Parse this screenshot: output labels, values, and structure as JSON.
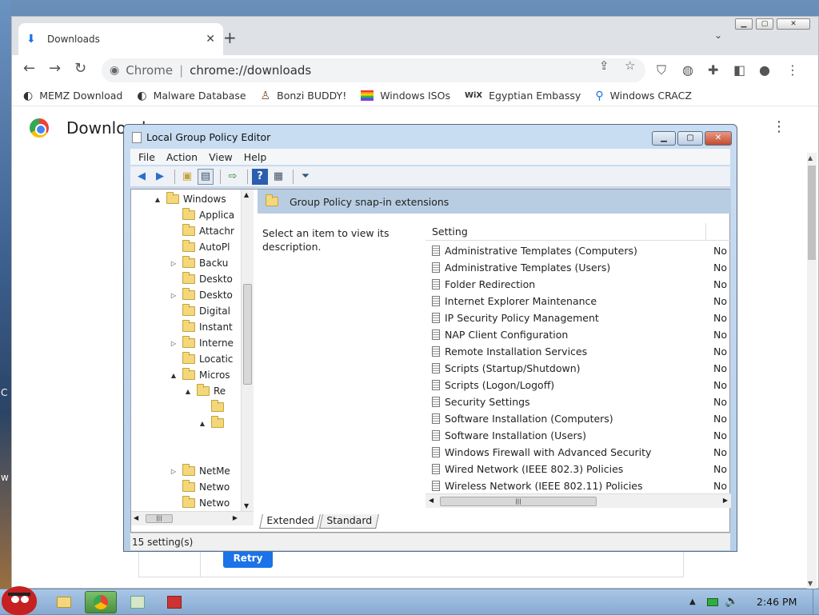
{
  "desktop": {
    "fragment_1": "C",
    "fragment_2": "w"
  },
  "chrome": {
    "tab_title": "Downloads",
    "omnibox_site": "Chrome",
    "omnibox_url": "chrome://downloads",
    "page_title": "Downloads",
    "retry_label": "Retry",
    "bookmarks": [
      {
        "label": "MEMZ Download",
        "icon": "globe-icon"
      },
      {
        "label": "Malware Database",
        "icon": "globe-icon"
      },
      {
        "label": "Bonzi BUDDY!",
        "icon": "bonzi-icon"
      },
      {
        "label": "Windows ISOs",
        "icon": "windows-flag-icon"
      },
      {
        "label": "Egyptian Embassy",
        "icon": "wix-icon"
      },
      {
        "label": "Windows CRACZ",
        "icon": "search-icon"
      }
    ]
  },
  "gpedit": {
    "title": "Local Group Policy Editor",
    "menu": [
      "File",
      "Action",
      "View",
      "Help"
    ],
    "tree": [
      {
        "label": "Windows",
        "expander": "▲",
        "indent": 0
      },
      {
        "label": "Applica",
        "expander": "",
        "indent": 1
      },
      {
        "label": "Attachr",
        "expander": "",
        "indent": 1
      },
      {
        "label": "AutoPl",
        "expander": "",
        "indent": 1
      },
      {
        "label": "Backu",
        "expander": "▷",
        "indent": 1
      },
      {
        "label": "Deskto",
        "expander": "",
        "indent": 1
      },
      {
        "label": "Deskto",
        "expander": "▷",
        "indent": 1
      },
      {
        "label": "Digital",
        "expander": "",
        "indent": 1
      },
      {
        "label": "Instant",
        "expander": "",
        "indent": 1
      },
      {
        "label": "Interne",
        "expander": "▷",
        "indent": 1
      },
      {
        "label": "Locatic",
        "expander": "",
        "indent": 1
      },
      {
        "label": "Micros",
        "expander": "▲",
        "indent": 1
      },
      {
        "label": "Re",
        "expander": "▲",
        "indent": 2
      },
      {
        "label": "",
        "expander": "",
        "indent": 3
      },
      {
        "label": "",
        "expander": "▲",
        "indent": 3
      },
      {
        "label": "NetMe",
        "expander": "▷",
        "indent": 1
      },
      {
        "label": "Netwo",
        "expander": "",
        "indent": 1
      },
      {
        "label": "Netwo",
        "expander": "",
        "indent": 1
      }
    ],
    "header": "Group Policy snap-in extensions",
    "description": "Select an item to view its description.",
    "column_setting": "Setting",
    "settings": [
      {
        "name": "Administrative Templates (Computers)",
        "state": "No"
      },
      {
        "name": "Administrative Templates (Users)",
        "state": "No"
      },
      {
        "name": "Folder Redirection",
        "state": "No"
      },
      {
        "name": "Internet Explorer Maintenance",
        "state": "No"
      },
      {
        "name": "IP Security Policy Management",
        "state": "No"
      },
      {
        "name": "NAP Client Configuration",
        "state": "No"
      },
      {
        "name": "Remote Installation Services",
        "state": "No"
      },
      {
        "name": "Scripts (Startup/Shutdown)",
        "state": "No"
      },
      {
        "name": "Scripts (Logon/Logoff)",
        "state": "No"
      },
      {
        "name": "Security Settings",
        "state": "No"
      },
      {
        "name": "Software Installation (Computers)",
        "state": "No"
      },
      {
        "name": "Software Installation (Users)",
        "state": "No"
      },
      {
        "name": "Windows Firewall with Advanced Security",
        "state": "No"
      },
      {
        "name": "Wired Network (IEEE 802.3) Policies",
        "state": "No"
      },
      {
        "name": "Wireless Network (IEEE 802.11) Policies",
        "state": "No"
      }
    ],
    "tabs": [
      "Extended",
      "Standard"
    ],
    "status": "15 setting(s)"
  },
  "taskbar": {
    "clock": "2:46 PM"
  },
  "colors": {
    "chrome_accent": "#1a73e8",
    "gp_frame": "#b6cfe9",
    "taskbar": "#87aad1"
  }
}
